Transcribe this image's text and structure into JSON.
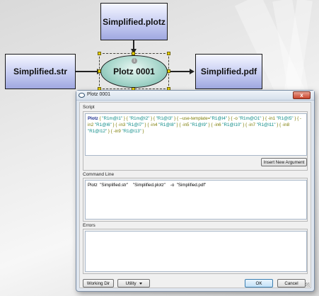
{
  "graph": {
    "nodes": {
      "top": "Simplified.plotz",
      "left": "Simplified.str",
      "center": "Plotz 0001",
      "right": "Simplified.pdf"
    },
    "center_info_glyph": "i"
  },
  "dialog": {
    "title": "Plotz 0001",
    "close_glyph": "x",
    "script_label": "Script",
    "script_tokens": [
      {
        "t": "Plotz",
        "k": "cmd"
      },
      {
        "t": " { ",
        "k": "arg"
      },
      {
        "t": "\"R1m@I1\"",
        "k": "str"
      },
      {
        "t": " } { ",
        "k": "arg"
      },
      {
        "t": "\"R1m@I2\"",
        "k": "str"
      },
      {
        "t": " } { ",
        "k": "arg"
      },
      {
        "t": "\"R1@I3\"",
        "k": "str"
      },
      {
        "t": " } { --use-template=",
        "k": "arg"
      },
      {
        "t": "\"R1@I4\"",
        "k": "str"
      },
      {
        "t": " } { -o ",
        "k": "arg"
      },
      {
        "t": "\"R1m@O1\"",
        "k": "str"
      },
      {
        "t": " } { -in1 ",
        "k": "arg"
      },
      {
        "t": "\"R1@I5\"",
        "k": "str"
      },
      {
        "t": " } { -in2 ",
        "k": "arg"
      },
      {
        "t": "\"R1@I6\"",
        "k": "str"
      },
      {
        "t": " } { -in3 ",
        "k": "arg"
      },
      {
        "t": "\"R1@I7\"",
        "k": "str"
      },
      {
        "t": " } { -in4 ",
        "k": "arg"
      },
      {
        "t": "\"R1@I8\"",
        "k": "str"
      },
      {
        "t": " } { -in5 ",
        "k": "arg"
      },
      {
        "t": "\"R1@I9\"",
        "k": "str"
      },
      {
        "t": " } { -in6 ",
        "k": "arg"
      },
      {
        "t": "\"R1@I10\"",
        "k": "str"
      },
      {
        "t": " } { -in7 ",
        "k": "arg"
      },
      {
        "t": "\"R1@I11\"",
        "k": "str"
      },
      {
        "t": " } { -in8 ",
        "k": "arg"
      },
      {
        "t": "\"R1@I12\"",
        "k": "str"
      },
      {
        "t": " } { -in9 ",
        "k": "arg"
      },
      {
        "t": "\"R1@I13\"",
        "k": "str"
      },
      {
        "t": " }",
        "k": "arg"
      }
    ],
    "insert_argument_label": "Insert New Argument",
    "command_line_label": "Command Line",
    "command_line_text": "Plotz  \"Simplified.str\"    \"Simplified.plotz\"    -o  \"Simplified.pdf\"",
    "errors_label": "Errors",
    "errors_text": "",
    "working_dir_label": "Working Dir",
    "utility_label": "Utility",
    "ok_label": "OK",
    "cancel_label": "Cancel"
  },
  "colors": {
    "node_fill": "#c7cdf2",
    "center_fill": "#a7d6cb",
    "selection": "#e6cf00",
    "close_button": "#c9452c"
  }
}
